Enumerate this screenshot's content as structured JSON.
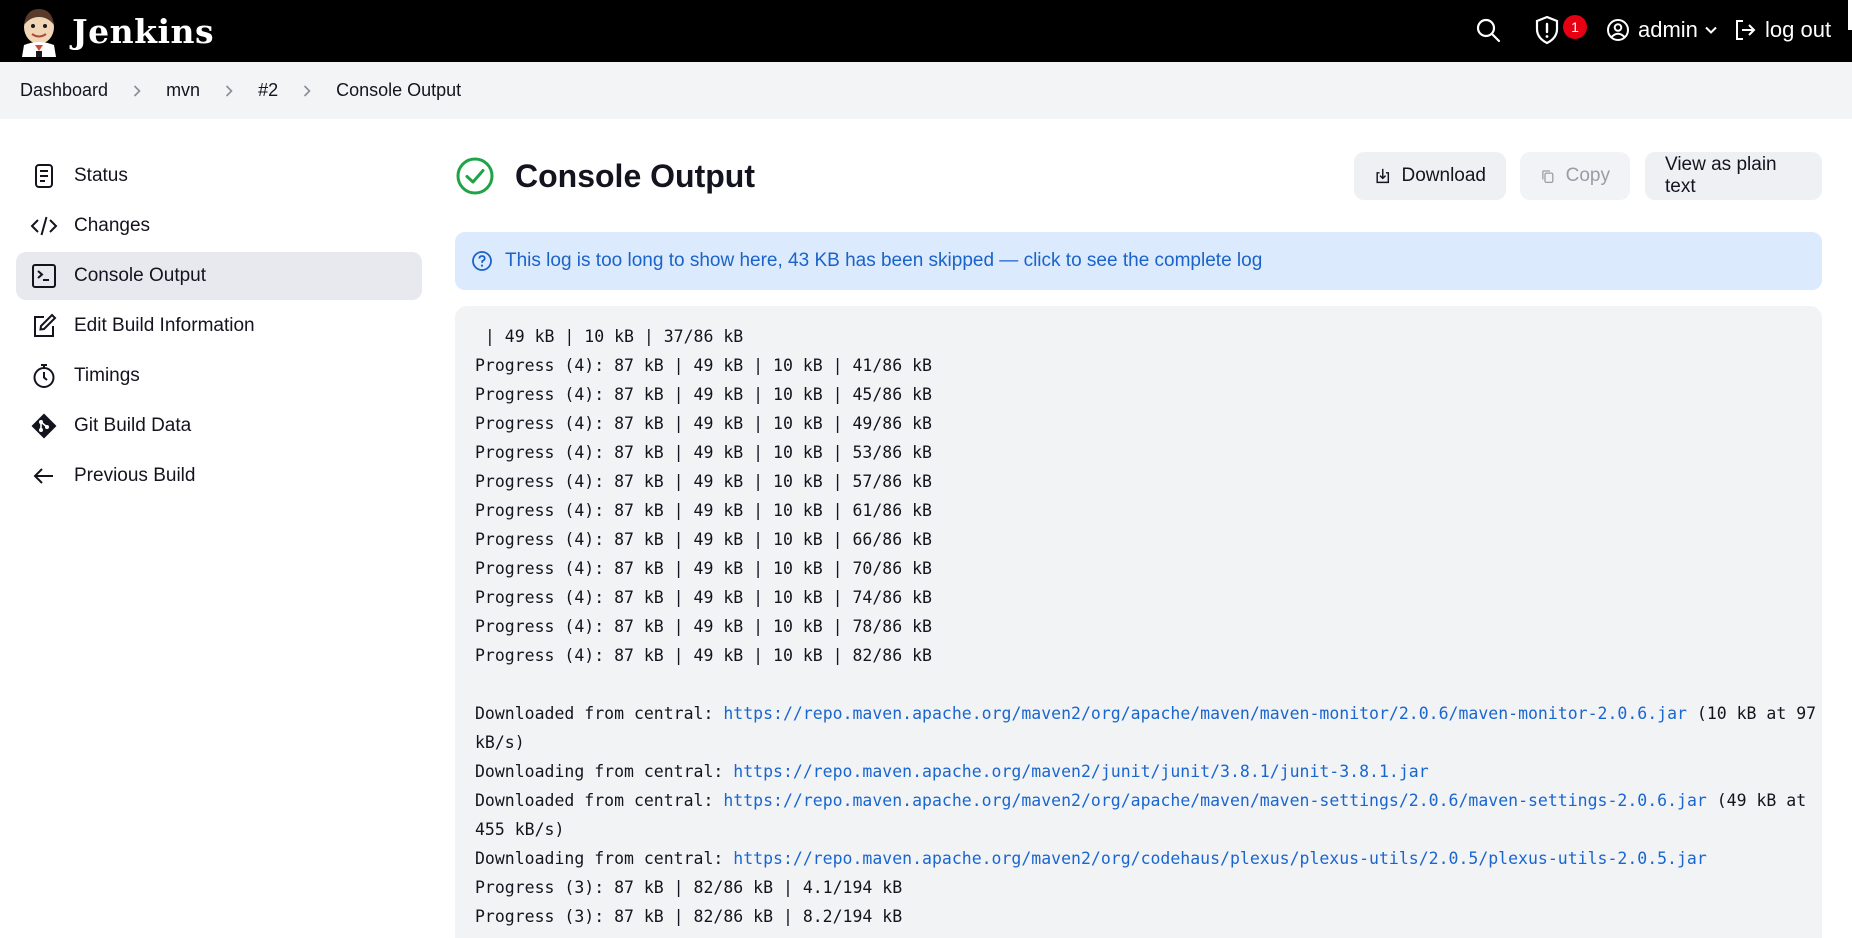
{
  "header": {
    "brand": "Jenkins",
    "search_icon": "search-icon",
    "security_badge_count": "1",
    "user": "admin",
    "logout": "log out"
  },
  "breadcrumb": [
    "Dashboard",
    "mvn",
    "#2",
    "Console Output"
  ],
  "sidebar": {
    "items": [
      {
        "label": "Status",
        "icon": "document-icon"
      },
      {
        "label": "Changes",
        "icon": "code-icon"
      },
      {
        "label": "Console Output",
        "icon": "terminal-icon",
        "active": true
      },
      {
        "label": "Edit Build Information",
        "icon": "edit-icon"
      },
      {
        "label": "Timings",
        "icon": "stopwatch-icon"
      },
      {
        "label": "Git Build Data",
        "icon": "git-icon"
      },
      {
        "label": "Previous Build",
        "icon": "arrow-left-icon"
      }
    ]
  },
  "main": {
    "title": "Console Output",
    "status_color": "#1ea446",
    "buttons": {
      "download": "Download",
      "copy": "Copy",
      "plain": "View as plain text"
    },
    "notice": "This log is too long to show here, 43 KB has been skipped — click to see the complete log",
    "console_lines": [
      {
        "text": " | 49 kB | 10 kB | 37/86 kB"
      },
      {
        "text": "Progress (4): 87 kB | 49 kB | 10 kB | 41/86 kB"
      },
      {
        "text": "Progress (4): 87 kB | 49 kB | 10 kB | 45/86 kB"
      },
      {
        "text": "Progress (4): 87 kB | 49 kB | 10 kB | 49/86 kB"
      },
      {
        "text": "Progress (4): 87 kB | 49 kB | 10 kB | 53/86 kB"
      },
      {
        "text": "Progress (4): 87 kB | 49 kB | 10 kB | 57/86 kB"
      },
      {
        "text": "Progress (4): 87 kB | 49 kB | 10 kB | 61/86 kB"
      },
      {
        "text": "Progress (4): 87 kB | 49 kB | 10 kB | 66/86 kB"
      },
      {
        "text": "Progress (4): 87 kB | 49 kB | 10 kB | 70/86 kB"
      },
      {
        "text": "Progress (4): 87 kB | 49 kB | 10 kB | 74/86 kB"
      },
      {
        "text": "Progress (4): 87 kB | 49 kB | 10 kB | 78/86 kB"
      },
      {
        "text": "Progress (4): 87 kB | 49 kB | 10 kB | 82/86 kB"
      },
      {
        "text": ""
      },
      {
        "text": "Downloaded from central: ",
        "link": "https://repo.maven.apache.org/maven2/org/apache/maven/maven-monitor/2.0.6/maven-monitor-2.0.6.jar",
        "suffix": " (10 kB at 97"
      },
      {
        "text": "kB/s)"
      },
      {
        "text": "Downloading from central: ",
        "link": "https://repo.maven.apache.org/maven2/junit/junit/3.8.1/junit-3.8.1.jar"
      },
      {
        "text": "Downloaded from central: ",
        "link": "https://repo.maven.apache.org/maven2/org/apache/maven/maven-settings/2.0.6/maven-settings-2.0.6.jar",
        "suffix": " (49 kB at"
      },
      {
        "text": "455 kB/s)"
      },
      {
        "text": "Downloading from central: ",
        "link": "https://repo.maven.apache.org/maven2/org/codehaus/plexus/plexus-utils/2.0.5/plexus-utils-2.0.5.jar"
      },
      {
        "text": "Progress (3): 87 kB | 82/86 kB | 4.1/194 kB"
      },
      {
        "text": "Progress (3): 87 kB | 82/86 kB | 8.2/194 kB"
      }
    ]
  }
}
